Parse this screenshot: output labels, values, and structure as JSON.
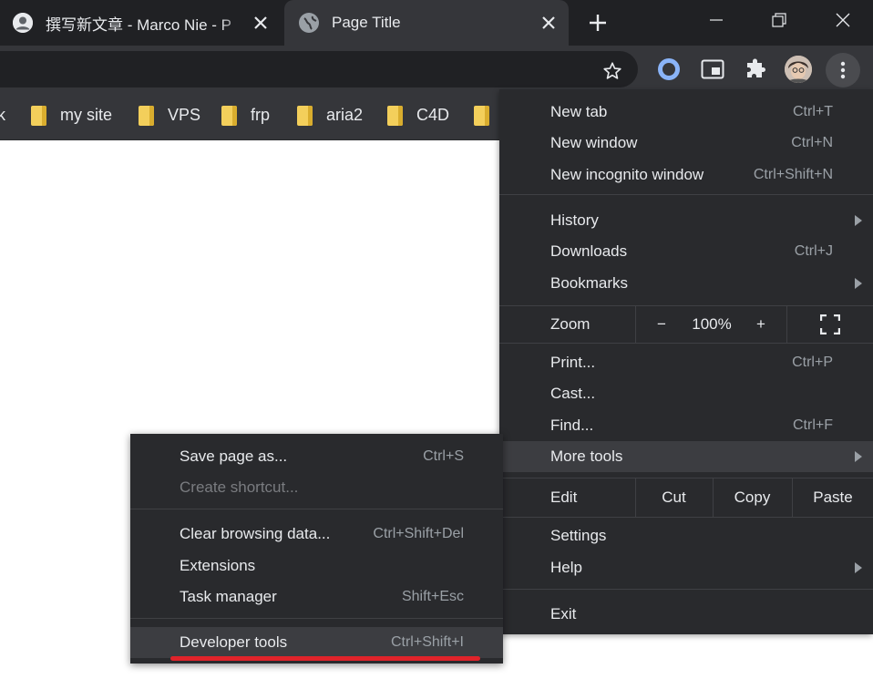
{
  "tabs": [
    {
      "title": "撰写新文章 - Marco Nie - P",
      "active": false,
      "icon": "person-icon"
    },
    {
      "title": "Page Title",
      "active": true,
      "icon": "globe-icon"
    }
  ],
  "new_tab_label": "+",
  "window_controls": {
    "minimize": "minimize-icon",
    "maximize": "restore-icon",
    "close": "close-icon"
  },
  "bookmarks": [
    {
      "label": "k"
    },
    {
      "label": "my site"
    },
    {
      "label": "VPS"
    },
    {
      "label": "frp"
    },
    {
      "label": "aria2"
    },
    {
      "label": "C4D"
    },
    {
      "label": ""
    }
  ],
  "menu": {
    "items_top": [
      {
        "label": "New tab",
        "shortcut": "Ctrl+T"
      },
      {
        "label": "New window",
        "shortcut": "Ctrl+N"
      },
      {
        "label": "New incognito window",
        "shortcut": "Ctrl+Shift+N"
      }
    ],
    "items_history": [
      {
        "label": "History",
        "shortcut": "",
        "submenu": true
      },
      {
        "label": "Downloads",
        "shortcut": "Ctrl+J",
        "submenu": false
      },
      {
        "label": "Bookmarks",
        "shortcut": "",
        "submenu": true
      }
    ],
    "zoom": {
      "label": "Zoom",
      "minus": "−",
      "value": "100%",
      "plus": "+"
    },
    "items_tools": [
      {
        "label": "Print...",
        "shortcut": "Ctrl+P"
      },
      {
        "label": "Cast...",
        "shortcut": ""
      },
      {
        "label": "Find...",
        "shortcut": "Ctrl+F"
      },
      {
        "label": "More tools",
        "shortcut": "",
        "submenu": true,
        "highlighted": true
      }
    ],
    "edit": {
      "label": "Edit",
      "cut": "Cut",
      "copy": "Copy",
      "paste": "Paste"
    },
    "items_settings": [
      {
        "label": "Settings",
        "submenu": false
      },
      {
        "label": "Help",
        "submenu": true
      }
    ],
    "exit": {
      "label": "Exit"
    }
  },
  "submenu": {
    "items": [
      {
        "label": "Save page as...",
        "shortcut": "Ctrl+S",
        "disabled": false
      },
      {
        "label": "Create shortcut...",
        "shortcut": "",
        "disabled": true
      },
      {
        "label": "Clear browsing data...",
        "shortcut": "Ctrl+Shift+Del",
        "disabled": false
      },
      {
        "label": "Extensions",
        "shortcut": "",
        "disabled": false
      },
      {
        "label": "Task manager",
        "shortcut": "Shift+Esc",
        "disabled": false
      },
      {
        "label": "Developer tools",
        "shortcut": "Ctrl+Shift+I",
        "disabled": false,
        "highlighted": true
      }
    ]
  },
  "colors": {
    "tabstrip": "#202124",
    "toolbar": "#35363a",
    "menu_bg": "#292a2d",
    "highlight": "#3c3d41",
    "annotation_underline": "#e0232a",
    "folder": "#f3cf5b"
  }
}
